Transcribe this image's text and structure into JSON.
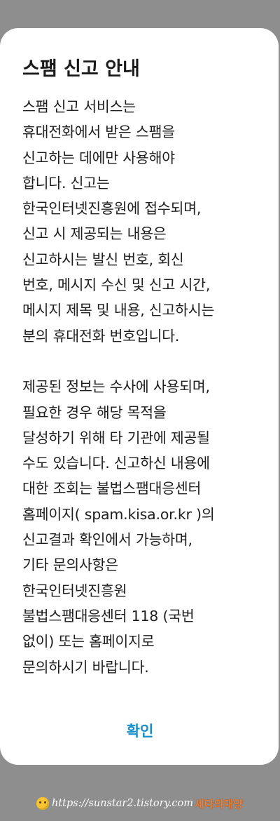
{
  "dialog": {
    "title": "스팸 신고 안내",
    "message_lines": [
      "스팸 신고 서비스는",
      "휴대전화에서 받은 스팸을",
      "신고하는 데에만 사용해야",
      "합니다. 신고는",
      "한국인터넷진흥원에 접수되며,",
      "신고 시 제공되는 내용은",
      "신고하시는 발신 번호, 회신",
      "번호, 메시지 수신 및 신고 시간,",
      "메시지 제목 및 내용, 신고하시는",
      "분의 휴대전화 번호입니다.",
      "",
      "제공된 정보는 수사에 사용되며,",
      "필요한 경우 해당 목적을",
      "달성하기 위해 타 기관에 제공될",
      "수도 있습니다. 신고하신 내용에",
      "대한 조회는 불법스팸대응센터",
      "홈페이지( spam.kisa.or.kr )의",
      "신고결과 확인에서 가능하며,",
      "기타 문의사항은",
      "한국인터넷진흥원",
      "불법스팸대응센터 118 (국번",
      "없이) 또는 홈페이지로",
      "문의하시기 바랍니다."
    ],
    "confirm_label": "확인"
  },
  "watermark": {
    "icon": "smiley-emoji-icon",
    "url": "https://sunstar2.tistory.com",
    "name": "세타의태양"
  },
  "colors": {
    "backdrop": "#8e8e8e",
    "dialog_background": "#ffffff",
    "accent": "#1b8fc7",
    "text": "#1e1e1e"
  }
}
